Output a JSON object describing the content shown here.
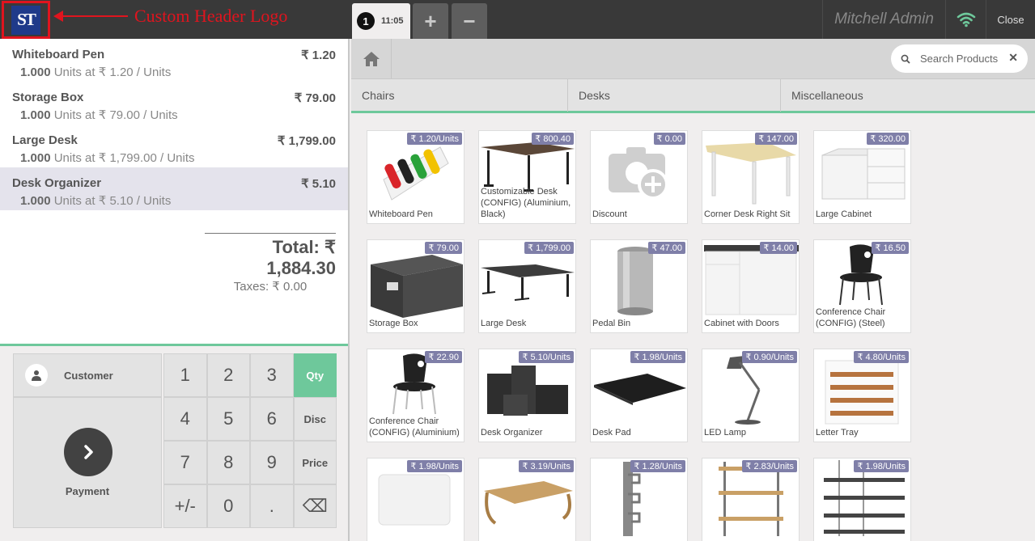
{
  "annotation": {
    "label": "Custom Header Logo"
  },
  "logo": {
    "text": "ST"
  },
  "header": {
    "order_number": "1",
    "order_time": "11:05",
    "add_label": "+",
    "remove_label": "−",
    "user": "Mitchell Admin",
    "close_label": "Close",
    "wifi_icon": "wifi-icon",
    "accent_color": "#6ec89b"
  },
  "order": {
    "lines": [
      {
        "name": "Whiteboard Pen",
        "price": "₹ 1.20",
        "qty": "1.000",
        "info": "Units at ₹ 1.20 / Units"
      },
      {
        "name": "Storage Box",
        "price": "₹ 79.00",
        "qty": "1.000",
        "info": "Units at ₹ 79.00 / Units"
      },
      {
        "name": "Large Desk",
        "price": "₹ 1,799.00",
        "qty": "1.000",
        "info": "Units at ₹ 1,799.00 / Units"
      },
      {
        "name": "Desk Organizer",
        "price": "₹ 5.10",
        "qty": "1.000",
        "info": "Units at ₹ 5.10 / Units"
      }
    ],
    "total": "Total: ₹ 1,884.30",
    "taxes": "Taxes: ₹ 0.00"
  },
  "pad": {
    "customer_label": "Customer",
    "payment_label": "Payment",
    "keys": [
      "1",
      "2",
      "3",
      "Qty",
      "4",
      "5",
      "6",
      "Disc",
      "7",
      "8",
      "9",
      "Price",
      "+/-",
      "0",
      ".",
      "⌫"
    ]
  },
  "products_header": {
    "search_placeholder": "Search Products",
    "clear_label": "✕",
    "categories": [
      "Chairs",
      "Desks",
      "Miscellaneous"
    ]
  },
  "products": [
    {
      "name": "Whiteboard Pen",
      "price": "₹ 1.20/Units"
    },
    {
      "name": "Customizable Desk (CONFIG) (Aluminium, Black)",
      "price": "₹ 800.40"
    },
    {
      "name": "Discount",
      "price": "₹ 0.00"
    },
    {
      "name": "Corner Desk Right Sit",
      "price": "₹ 147.00"
    },
    {
      "name": "Large Cabinet",
      "price": "₹ 320.00"
    },
    {
      "name": "Storage Box",
      "price": "₹ 79.00"
    },
    {
      "name": "Large Desk",
      "price": "₹ 1,799.00"
    },
    {
      "name": "Pedal Bin",
      "price": "₹ 47.00"
    },
    {
      "name": "Cabinet with Doors",
      "price": "₹ 14.00"
    },
    {
      "name": "Conference Chair (CONFIG) (Steel)",
      "price": "₹ 16.50"
    },
    {
      "name": "Conference Chair (CONFIG) (Aluminium)",
      "price": "₹ 22.90"
    },
    {
      "name": "Desk Organizer",
      "price": "₹ 5.10/Units"
    },
    {
      "name": "Desk Pad",
      "price": "₹ 1.98/Units"
    },
    {
      "name": "LED Lamp",
      "price": "₹ 0.90/Units"
    },
    {
      "name": "Letter Tray",
      "price": "₹ 4.80/Units"
    },
    {
      "name": "",
      "price": "₹ 1.98/Units"
    },
    {
      "name": "",
      "price": "₹ 3.19/Units"
    },
    {
      "name": "",
      "price": "₹ 1.28/Units"
    },
    {
      "name": "",
      "price": "₹ 2.83/Units"
    },
    {
      "name": "",
      "price": "₹ 1.98/Units"
    }
  ]
}
